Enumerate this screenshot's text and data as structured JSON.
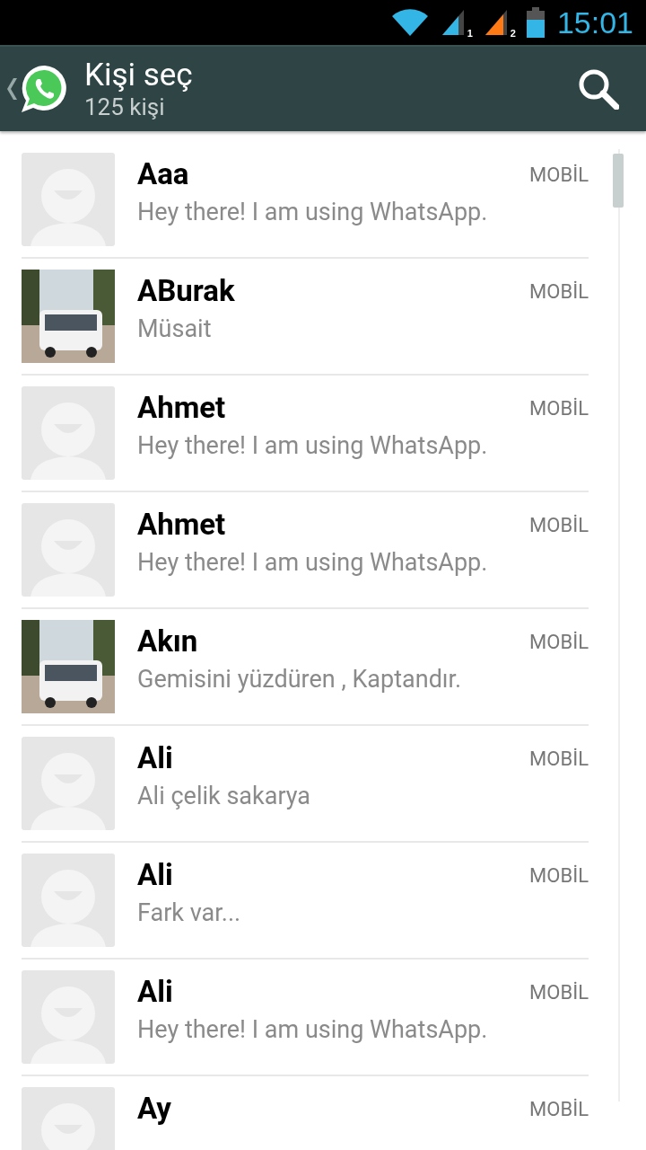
{
  "status_bar": {
    "time": "15:01",
    "sim_labels": [
      "1",
      "2"
    ]
  },
  "action_bar": {
    "title": "Kişi seç",
    "subtitle": "125 kişi"
  },
  "contacts": [
    {
      "name": "Aaa",
      "status": "Hey there! I am using WhatsApp.",
      "type": "MOBİL",
      "kind": "default"
    },
    {
      "name": "ABurak",
      "status": "Müsait",
      "type": "MOBİL",
      "kind": "picture"
    },
    {
      "name": "Ahmet",
      "status": "Hey there! I am using WhatsApp.",
      "type": "MOBİL",
      "kind": "default"
    },
    {
      "name": "Ahmet",
      "status": "Hey there! I am using WhatsApp.",
      "type": "MOBİL",
      "kind": "default"
    },
    {
      "name": "Akın",
      "status": "Gemisini yüzdüren , Kaptandır.",
      "type": "MOBİL",
      "kind": "picture"
    },
    {
      "name": "Ali",
      "status": "Ali çelik sakarya",
      "type": "MOBİL",
      "kind": "default"
    },
    {
      "name": "Ali",
      "status": "Fark var...",
      "type": "MOBİL",
      "kind": "default"
    },
    {
      "name": "Ali",
      "status": "Hey there! I am using WhatsApp.",
      "type": "MOBİL",
      "kind": "default"
    },
    {
      "name": "Ay",
      "type": "MOBİL",
      "kind": "default"
    }
  ]
}
